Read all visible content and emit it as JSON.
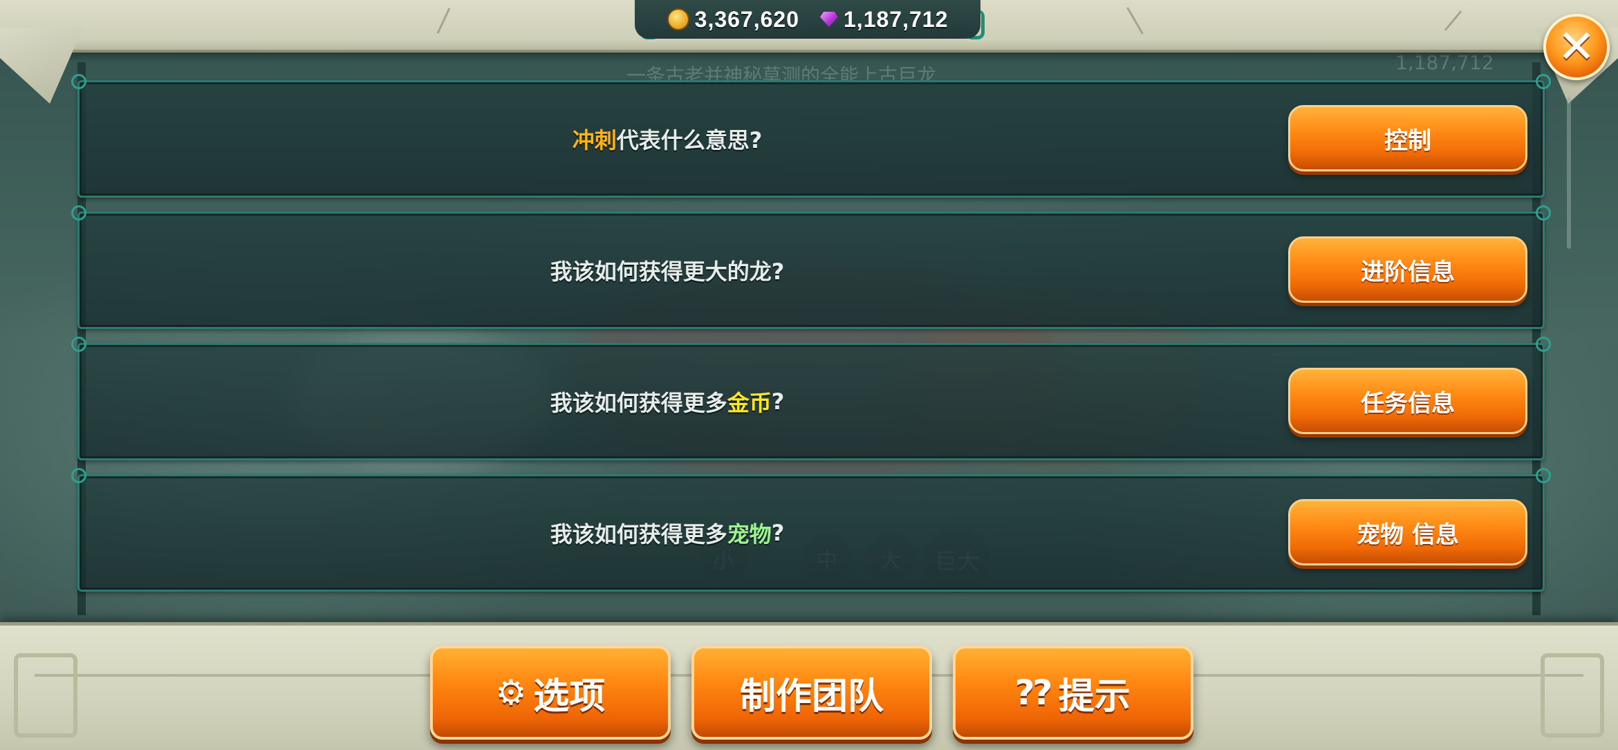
{
  "currency": {
    "gold": "3,367,620",
    "gems": "1,187,712"
  },
  "background": {
    "title_ghost": "一条古老并神秘莫测的全能上古巨龙",
    "gems_ghost": "1,187,712",
    "size_pills": [
      "小",
      "中",
      "大",
      "巨大"
    ]
  },
  "faq": [
    {
      "q_hl": "冲刺",
      "q_rest": "代表什么意思?",
      "button": "控制"
    },
    {
      "q_pre": "我该如何获得更大的龙?",
      "button": "进阶信息"
    },
    {
      "q_pre": "我该如何获得更多 ",
      "q_hl": "金币",
      "q_post": "?",
      "button": "任务信息"
    },
    {
      "q_pre": "我该如何获得更多 ",
      "q_hl": "宠物",
      "q_post": "?",
      "button": "宠物 信息"
    }
  ],
  "bottom_buttons": {
    "options": "选项",
    "credits": "制作团队",
    "tips": "提示"
  },
  "icons": {
    "close": "close-icon",
    "gold": "gold-coin-icon",
    "gem": "gem-icon",
    "options": "gear-icon",
    "tips": "hint-icon"
  },
  "colors": {
    "accent_orange": "#ff8a14",
    "highlight_orange": "#ffb21a",
    "highlight_yellow": "#ffe82a",
    "highlight_green": "#9cf58f"
  }
}
